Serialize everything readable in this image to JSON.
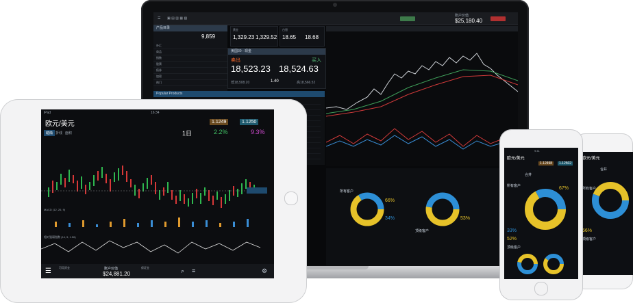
{
  "laptop": {
    "account_value": "$25,180.40",
    "account_label": "账户价值",
    "side_title": "产品目录",
    "side_value": "9,859",
    "side_items": [
      "外汇",
      "商品",
      "指数",
      "股票",
      "债券",
      "加密",
      "热门"
    ],
    "quotes": [
      {
        "title": "黄金",
        "sell": "1,329.23",
        "buy": "1,329.52"
      },
      {
        "title": "白银",
        "sell": "18.65",
        "buy": "18.68"
      }
    ],
    "trade_panel": {
      "title": "美国30 - 现金",
      "sell_label": "卖出",
      "buy_label": "买入",
      "sell": "18,523.23",
      "buy": "18,524.63",
      "low": "低18,508.20",
      "spread": "1.40",
      "high": "高18,566.52"
    },
    "popular_title": "Popular Products",
    "sentiment_labels": [
      "所有客户",
      "66%",
      "34%",
      "53%",
      "顶级客户"
    ]
  },
  "tablet": {
    "status_left": "iPad",
    "status_time": "16:34",
    "pair_title": "欧元/美元",
    "sell_price": "1.1249",
    "buy_price": "1.1250",
    "tabs": [
      "蜡烛",
      "折线",
      "面积"
    ],
    "period": "1日",
    "change_pos": "2.2%",
    "change_neg": "9.3%",
    "indicator1": "MACD (12, 26, 9)",
    "indicator2": "相对强弱指数 (14, 5, 1.56)",
    "footer_label": "账户价值",
    "footer_value": "$24,881.20",
    "footer_small_left": "可用资金",
    "footer_small_right": "保证金"
  },
  "phone1": {
    "status_time": "9:41",
    "pair_title": "欧元/美元",
    "sell_price": "1.12498",
    "buy_price": "1.12502",
    "tab": "合并",
    "label_all": "所有客户",
    "pct_a": "67%",
    "pct_b": "33%",
    "pct_c": "52%",
    "label_top": "顶级客户"
  },
  "phone2": {
    "status_time": "9:41",
    "pair_title": "欧元/美元",
    "tab": "合并",
    "label_all": "所有客户",
    "pct_a": "56%",
    "label_top": "顶级客户"
  }
}
